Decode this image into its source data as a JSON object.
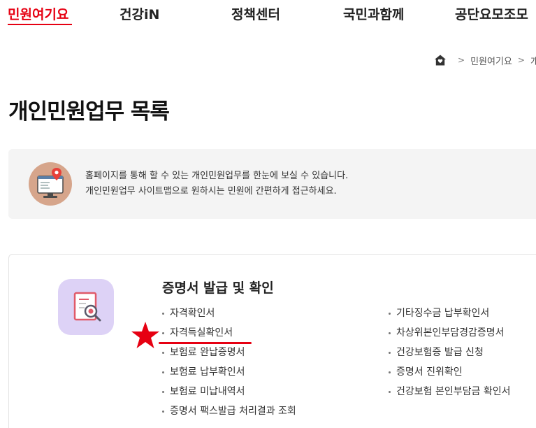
{
  "nav": {
    "items": [
      {
        "label": "민원여기요",
        "active": true
      },
      {
        "label": "건강iN",
        "active": false
      },
      {
        "label": "정책센터",
        "active": false
      },
      {
        "label": "국민과함께",
        "active": false
      },
      {
        "label": "공단요모조모",
        "active": false
      }
    ]
  },
  "breadcrumb": {
    "home_icon": "home-icon",
    "items": [
      "민원여기요",
      "개인"
    ]
  },
  "page": {
    "title": "개인민원업무 목록"
  },
  "info": {
    "icon": "monitor-location-icon",
    "line1": "홈페이지를 통해 할 수 있는 개인민원업무를 한눈에 보실 수 있습니다.",
    "line2": "개인민원업무 사이트맵으로 원하시는 민원에 간편하게 접근하세요."
  },
  "section": {
    "icon": "certificate-search-icon",
    "title": "증명서 발급 및 확인",
    "left_items": [
      "자격확인서",
      "자격득실확인서",
      "보험료 완납증명서",
      "보험료 납부확인서",
      "보험료 미납내역서",
      "증명서 팩스발급 처리결과 조회"
    ],
    "right_items": [
      "기타징수금 납부확인서",
      "차상위본인부담경감증명서",
      "건강보험증 발급 신청",
      "증명서 진위확인",
      "건강보험 본인부담금 확인서"
    ]
  },
  "annotation": {
    "highlighted_item": "자격득실확인서",
    "mark": "red-star-icon",
    "color": "#e60012"
  },
  "colors": {
    "accent": "#e60012",
    "info_bg": "#f4f4f4",
    "info_icon_bg": "#d6a58b",
    "card_icon_bg": "#ddd2f6"
  }
}
